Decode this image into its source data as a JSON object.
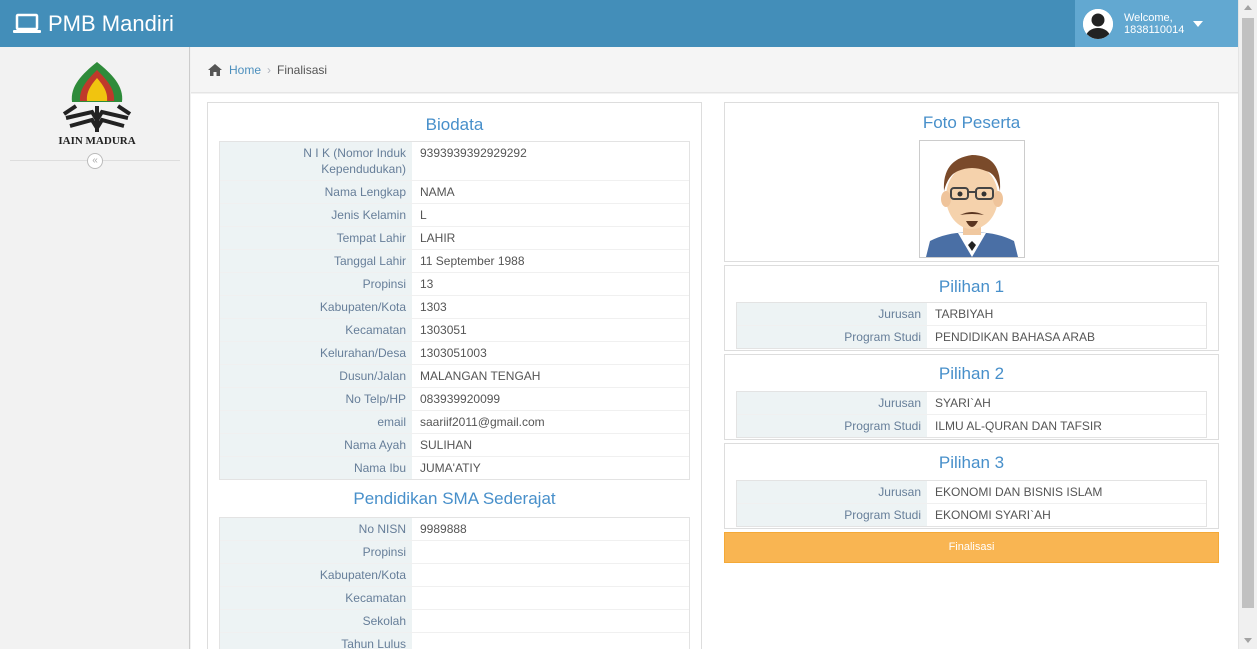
{
  "navbar": {
    "brand_icon": "laptop-icon",
    "brand_text": "PMB Mandiri",
    "user": {
      "avatar_icon": "user-avatar-icon",
      "welcome": "Welcome,",
      "username": "1838110014",
      "caret_icon": "caret-down-icon"
    }
  },
  "sidebar": {
    "logo_text": "IAIN MADURA",
    "collapse_icon": "double-chevron-left-icon",
    "collapse_glyph": "«"
  },
  "breadcrumb": {
    "home_icon": "home-icon",
    "home": "Home",
    "separator": "›",
    "current": "Finalisasi"
  },
  "biodata": {
    "title": "Biodata",
    "rows": [
      {
        "label": "N I K (Nomor Induk Kependudukan)",
        "value": "9393939392929292"
      },
      {
        "label": "Nama Lengkap",
        "value": "NAMA"
      },
      {
        "label": "Jenis Kelamin",
        "value": "L"
      },
      {
        "label": "Tempat Lahir",
        "value": "LAHIR"
      },
      {
        "label": "Tanggal Lahir",
        "value": "11 September 1988"
      },
      {
        "label": "Propinsi",
        "value": "13"
      },
      {
        "label": "Kabupaten/Kota",
        "value": "1303"
      },
      {
        "label": "Kecamatan",
        "value": "1303051"
      },
      {
        "label": "Kelurahan/Desa",
        "value": "1303051003"
      },
      {
        "label": "Dusun/Jalan",
        "value": "MALANGAN TENGAH"
      },
      {
        "label": "No Telp/HP",
        "value": "083939920099"
      },
      {
        "label": "email",
        "value": "saariif2011@gmail.com"
      },
      {
        "label": "Nama Ayah",
        "value": "SULIHAN"
      },
      {
        "label": "Nama Ibu",
        "value": "JUMA'ATIY"
      }
    ]
  },
  "pendidikan": {
    "title": "Pendidikan SMA Sederajat",
    "rows": [
      {
        "label": "No NISN",
        "value": "9989888"
      },
      {
        "label": "Propinsi",
        "value": ""
      },
      {
        "label": "Kabupaten/Kota",
        "value": ""
      },
      {
        "label": "Kecamatan",
        "value": ""
      },
      {
        "label": "Sekolah",
        "value": ""
      },
      {
        "label": "Tahun Lulus",
        "value": ""
      }
    ]
  },
  "foto": {
    "title": "Foto Peserta",
    "image_icon": "participant-avatar-icon"
  },
  "pilihan": [
    {
      "title": "Pilihan 1",
      "rows": [
        {
          "label": "Jurusan",
          "value": "TARBIYAH"
        },
        {
          "label": "Program Studi",
          "value": "PENDIDIKAN BAHASA ARAB"
        }
      ]
    },
    {
      "title": "Pilihan 2",
      "rows": [
        {
          "label": "Jurusan",
          "value": "SYARI`AH"
        },
        {
          "label": "Program Studi",
          "value": "ILMU AL-QURAN DAN TAFSIR"
        }
      ]
    },
    {
      "title": "Pilihan 3",
      "rows": [
        {
          "label": "Jurusan",
          "value": "EKONOMI DAN BISNIS ISLAM"
        },
        {
          "label": "Program Studi",
          "value": "EKONOMI SYARI`AH"
        }
      ]
    }
  ],
  "finalisasi_button": "Finalisasi",
  "colors": {
    "navbar": "#438eb9",
    "user_menu": "#62a8d1",
    "title_blue": "#478fca",
    "label_bg": "#edf3f4",
    "button_orange": "#f9b552"
  }
}
